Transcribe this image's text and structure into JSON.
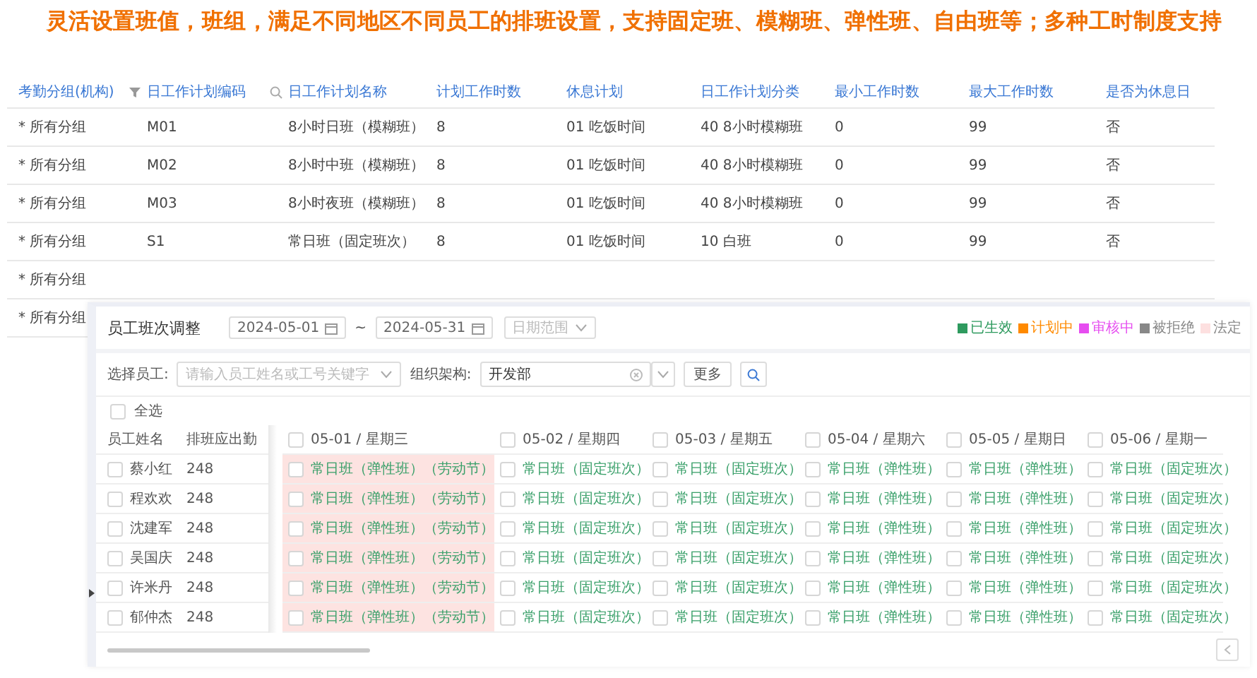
{
  "headline": "灵活设置班值，班组，满足不同地区不同员工的排班设置，支持固定班、模糊班、弹性班、自由班等；多种工时制度支持",
  "plan_table": {
    "columns": [
      {
        "label": "考勤分组(机构)",
        "kind": "plain"
      },
      {
        "label": "日工作计划编码",
        "kind": "filter"
      },
      {
        "label": "日工作计划名称",
        "kind": "search"
      },
      {
        "label": "计划工作时数",
        "kind": "plain"
      },
      {
        "label": "休息计划",
        "kind": "plain"
      },
      {
        "label": "日工作计划分类",
        "kind": "plain"
      },
      {
        "label": "最小工作时数",
        "kind": "plain"
      },
      {
        "label": "最大工作时数",
        "kind": "plain"
      },
      {
        "label": "是否为休息日",
        "kind": "plain"
      }
    ],
    "rows": [
      [
        "* 所有分组",
        "M01",
        "8小时日班（模糊班）",
        "8",
        "01 吃饭时间",
        "40 8小时模糊班",
        "0",
        "99",
        "否"
      ],
      [
        "* 所有分组",
        "M02",
        "8小时中班（模糊班）",
        "8",
        "01 吃饭时间",
        "40 8小时模糊班",
        "0",
        "99",
        "否"
      ],
      [
        "* 所有分组",
        "M03",
        "8小时夜班（模糊班）",
        "8",
        "01 吃饭时间",
        "40 8小时模糊班",
        "0",
        "99",
        "否"
      ],
      [
        "* 所有分组",
        "S1",
        "常日班（固定班次）",
        "8",
        "01 吃饭时间",
        "10 白班",
        "0",
        "99",
        "否"
      ],
      [
        "* 所有分组"
      ],
      [
        "* 所有分组"
      ]
    ]
  },
  "dialog": {
    "title": "员工班次调整",
    "date_from": "2024-05-01",
    "date_separator": "~",
    "date_to": "2024-05-31",
    "range_select": {
      "placeholder": "日期范围"
    },
    "legend": [
      {
        "label": "已生效",
        "color": "#2e9a5e",
        "kind": "status"
      },
      {
        "label": "计划中",
        "color": "#ff8a00",
        "kind": "status"
      },
      {
        "label": "审核中",
        "color": "#e64df0",
        "kind": "status"
      },
      {
        "label": "被拒绝",
        "color": "#888888",
        "kind": "muted"
      },
      {
        "label": "法定",
        "color": "#fde0e0",
        "kind": "muted"
      }
    ],
    "employee_filter": {
      "label": "选择员工:",
      "placeholder": "请输入员工姓名或工号关键字"
    },
    "org_filter": {
      "label": "组织架构:",
      "value": "开发部"
    },
    "more_button": "更多",
    "select_all": {
      "label": "全选",
      "checked": false
    },
    "columns": [
      "员工姓名",
      "排班应出勤"
    ],
    "dates": [
      {
        "label": "05-01 / 星期三",
        "checked": false,
        "holiday": true
      },
      {
        "label": "05-02 / 星期四",
        "checked": false,
        "holiday": false
      },
      {
        "label": "05-03 / 星期五",
        "checked": false,
        "holiday": false
      },
      {
        "label": "05-04 / 星期六",
        "checked": false,
        "holiday": false
      },
      {
        "label": "05-05 / 星期日",
        "checked": false,
        "holiday": false
      },
      {
        "label": "05-06 / 星期一",
        "checked": false,
        "holiday": false
      }
    ],
    "employees": [
      {
        "name": "蔡小红",
        "checked": false,
        "attendance": "248",
        "shifts": [
          {
            "label": "常日班（弹性班）（劳动节）",
            "checked": false
          },
          {
            "label": "常日班（固定班次）",
            "checked": false
          },
          {
            "label": "常日班（固定班次）",
            "checked": false
          },
          {
            "label": "常日班（弹性班）",
            "checked": false
          },
          {
            "label": "常日班（弹性班）",
            "checked": false
          },
          {
            "label": "常日班（固定班次）",
            "checked": false
          }
        ]
      },
      {
        "name": "程欢欢",
        "checked": false,
        "attendance": "248",
        "shifts": [
          {
            "label": "常日班（弹性班）（劳动节）",
            "checked": false
          },
          {
            "label": "常日班（固定班次）",
            "checked": false
          },
          {
            "label": "常日班（固定班次）",
            "checked": false
          },
          {
            "label": "常日班（弹性班）",
            "checked": false
          },
          {
            "label": "常日班（弹性班）",
            "checked": false
          },
          {
            "label": "常日班（固定班次）",
            "checked": false
          }
        ]
      },
      {
        "name": "沈建军",
        "checked": false,
        "attendance": "248",
        "shifts": [
          {
            "label": "常日班（弹性班）（劳动节）",
            "checked": false
          },
          {
            "label": "常日班（固定班次）",
            "checked": false
          },
          {
            "label": "常日班（固定班次）",
            "checked": false
          },
          {
            "label": "常日班（弹性班）",
            "checked": false
          },
          {
            "label": "常日班（弹性班）",
            "checked": false
          },
          {
            "label": "常日班（固定班次）",
            "checked": false
          }
        ]
      },
      {
        "name": "吴国庆",
        "checked": false,
        "attendance": "248",
        "shifts": [
          {
            "label": "常日班（弹性班）（劳动节）",
            "checked": false
          },
          {
            "label": "常日班（固定班次）",
            "checked": false
          },
          {
            "label": "常日班（固定班次）",
            "checked": false
          },
          {
            "label": "常日班（弹性班）",
            "checked": false
          },
          {
            "label": "常日班（弹性班）",
            "checked": false
          },
          {
            "label": "常日班（固定班次）",
            "checked": false
          }
        ]
      },
      {
        "name": "许米丹",
        "checked": false,
        "attendance": "248",
        "shifts": [
          {
            "label": "常日班（弹性班）（劳动节）",
            "checked": false
          },
          {
            "label": "常日班（固定班次）",
            "checked": false
          },
          {
            "label": "常日班（固定班次）",
            "checked": false
          },
          {
            "label": "常日班（弹性班）",
            "checked": false
          },
          {
            "label": "常日班（弹性班）",
            "checked": false
          },
          {
            "label": "常日班（固定班次）",
            "checked": false
          }
        ]
      },
      {
        "name": "郁仲杰",
        "checked": false,
        "attendance": "248",
        "shifts": [
          {
            "label": "常日班（弹性班）（劳动节）",
            "checked": false
          },
          {
            "label": "常日班（固定班次）",
            "checked": false
          },
          {
            "label": "常日班（固定班次）",
            "checked": false
          },
          {
            "label": "常日班（弹性班）",
            "checked": false
          },
          {
            "label": "常日班（弹性班）",
            "checked": false
          },
          {
            "label": "常日班（固定班次）",
            "checked": false
          }
        ]
      }
    ]
  }
}
